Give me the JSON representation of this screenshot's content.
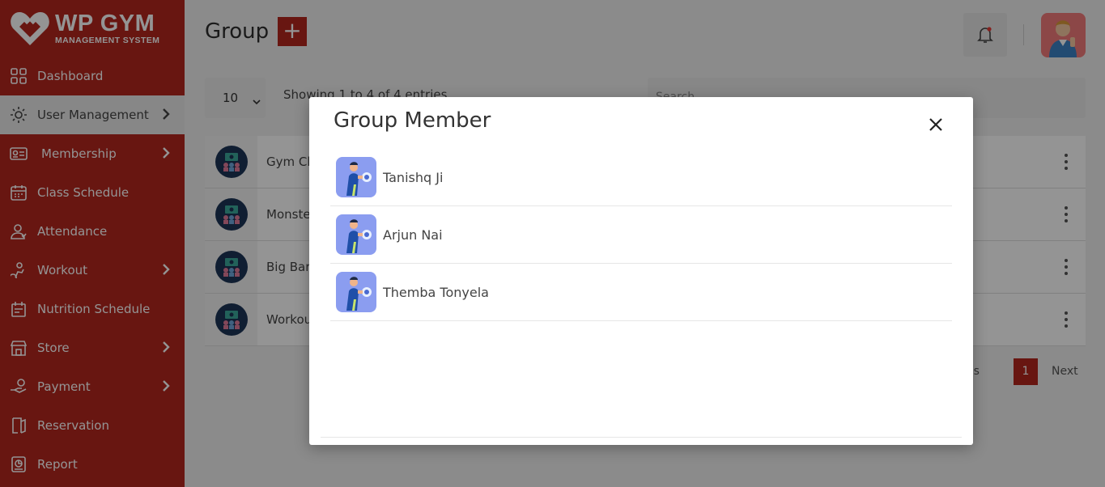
{
  "brand": {
    "title": "WP GYM",
    "subtitle": "MANAGEMENT SYSTEM"
  },
  "sidebar": {
    "items": [
      {
        "label": "Dashboard",
        "icon": "dashboard-grid-icon",
        "has_submenu": false,
        "active": false
      },
      {
        "label": "User Management",
        "icon": "users-gear-icon",
        "has_submenu": true,
        "active": true
      },
      {
        "label": "Membership",
        "icon": "membership-card-icon",
        "has_submenu": true,
        "active": false
      },
      {
        "label": "Class Schedule",
        "icon": "calendar-icon",
        "has_submenu": false,
        "active": false
      },
      {
        "label": "Attendance",
        "icon": "attendance-user-icon",
        "has_submenu": false,
        "active": false
      },
      {
        "label": "Workout",
        "icon": "workout-icon",
        "has_submenu": true,
        "active": false
      },
      {
        "label": "Nutrition Schedule",
        "icon": "nutrition-icon",
        "has_submenu": false,
        "active": false
      },
      {
        "label": "Store",
        "icon": "store-icon",
        "has_submenu": true,
        "active": false
      },
      {
        "label": "Payment",
        "icon": "payment-hand-icon",
        "has_submenu": true,
        "active": false
      },
      {
        "label": "Reservation",
        "icon": "reservation-icon",
        "has_submenu": false,
        "active": false
      },
      {
        "label": "Report",
        "icon": "report-icon",
        "has_submenu": false,
        "active": false
      }
    ]
  },
  "header": {
    "title": "Group",
    "add_label": "+"
  },
  "table_controls": {
    "page_length": "10",
    "info": "Showing 1 to 4 of 4 entries",
    "search_placeholder": "Search..."
  },
  "groups": [
    {
      "name": "Gym Cl"
    },
    {
      "name": "Monste"
    },
    {
      "name": "Big Barb"
    },
    {
      "name": "Workou"
    }
  ],
  "pagination": {
    "prev": "vious",
    "current": "1",
    "next": "Next"
  },
  "modal": {
    "title": "Group Member",
    "members": [
      {
        "name": "Tanishq Ji"
      },
      {
        "name": "Arjun Nai"
      },
      {
        "name": "Themba Tonyela"
      }
    ]
  },
  "colors": {
    "brand": "#b3261e",
    "overlay": "rgba(0,0,0,0.42)"
  }
}
